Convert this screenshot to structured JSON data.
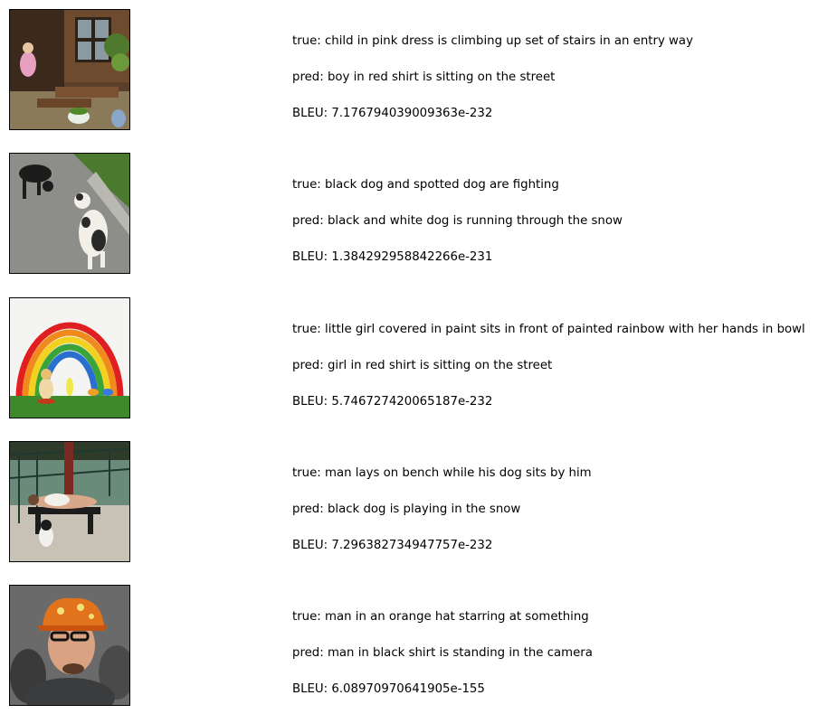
{
  "samples": [
    {
      "image": "child-on-stairs-photo",
      "true_label": "true: child in pink dress is climbing up set of stairs in an entry way",
      "pred_label": "pred: boy in red shirt is sitting on the street",
      "bleu_label": "BLEU: 7.176794039009363e-232"
    },
    {
      "image": "two-dogs-photo",
      "true_label": "true: black dog and spotted dog are fighting",
      "pred_label": "pred: black and white dog is running through the snow",
      "bleu_label": "BLEU: 1.384292958842266e-231"
    },
    {
      "image": "rainbow-painting-photo",
      "true_label": "true: little girl covered in paint sits in front of painted rainbow with her hands in bowl",
      "pred_label": "pred: girl in red shirt is sitting on the street",
      "bleu_label": "BLEU: 5.746727420065187e-232"
    },
    {
      "image": "man-on-bench-photo",
      "true_label": "true: man lays on bench while his dog sits by him",
      "pred_label": "pred: black dog is playing in the snow",
      "bleu_label": "BLEU: 7.296382734947757e-232"
    },
    {
      "image": "man-orange-hat-photo",
      "true_label": "true: man in an orange hat starring at something",
      "pred_label": "pred: man in black shirt is standing in the camera",
      "bleu_label": "BLEU: 6.08970970641905e-155"
    }
  ]
}
